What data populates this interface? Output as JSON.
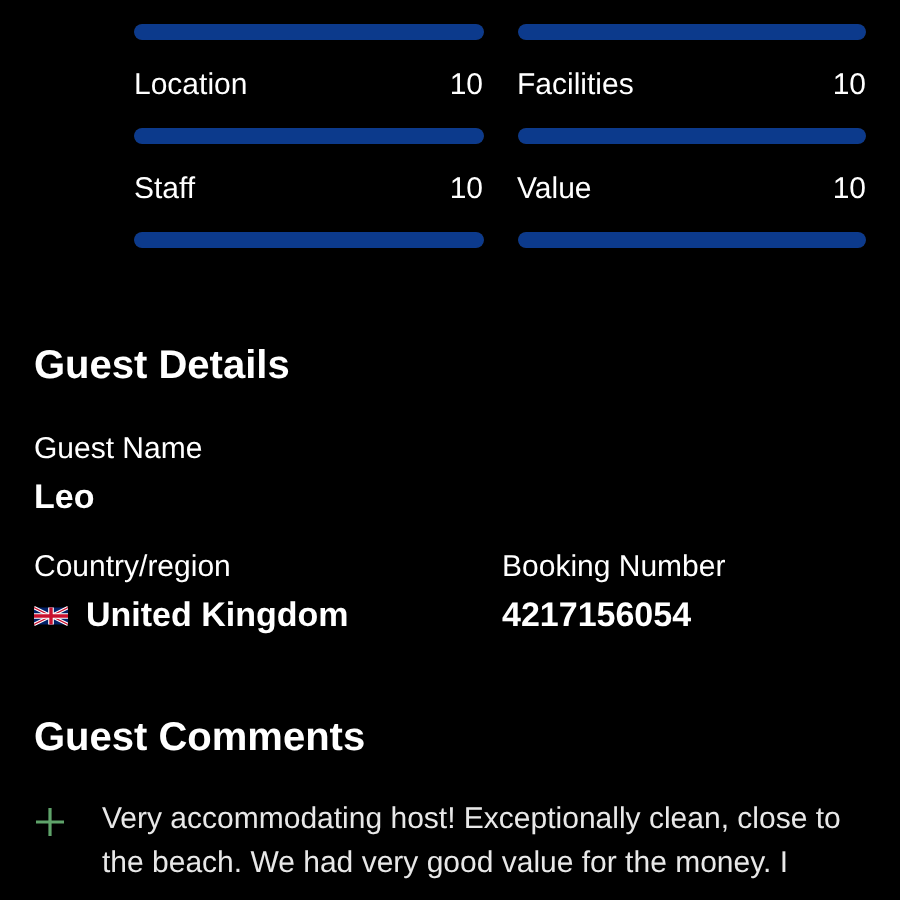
{
  "scores": [
    {
      "level": 1
    },
    {
      "level": 1
    },
    {
      "label": "Location",
      "value": "10",
      "level": 1
    },
    {
      "label": "Facilities",
      "value": "10",
      "level": 1
    },
    {
      "label": "Staff",
      "value": "10",
      "level": 1
    },
    {
      "label": "Value",
      "value": "10",
      "level": 1
    }
  ],
  "guest_details": {
    "title": "Guest Details",
    "guest_name_label": "Guest Name",
    "guest_name": "Leo",
    "country_label": "Country/region",
    "country": "United Kingdom",
    "booking_label": "Booking Number",
    "booking_number": "4217156054"
  },
  "guest_comments": {
    "title": "Guest Comments",
    "comments": [
      {
        "text": "Very accommodating host! Exceptionally clean, close to the beach. We had very good value for the money.  I"
      }
    ]
  }
}
